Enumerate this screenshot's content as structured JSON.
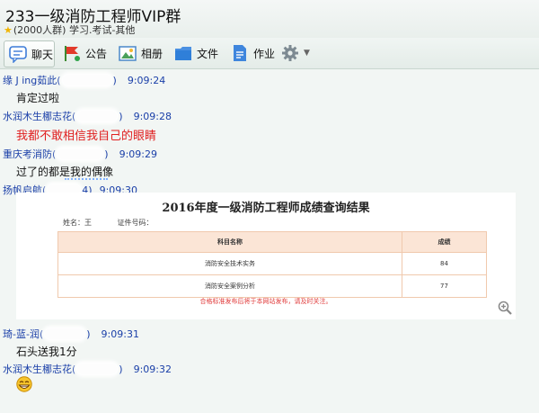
{
  "window": {
    "title": "233一级消防工程师VIP群",
    "subtitle": "(2000人群) 学习.考试-其他"
  },
  "toolbar": {
    "items": [
      {
        "label": "聊天",
        "icon": "chat-icon",
        "active": true
      },
      {
        "label": "公告",
        "icon": "announcement-icon"
      },
      {
        "label": "相册",
        "icon": "album-icon"
      },
      {
        "label": "文件",
        "icon": "folder-icon"
      },
      {
        "label": "作业",
        "icon": "homework-icon"
      },
      {
        "label": "",
        "icon": "gear-icon"
      }
    ]
  },
  "messages": [
    {
      "sender": "缘 J ing茹此(",
      "suffix": ")",
      "time": "9:09:24",
      "text": "肯定过啦"
    },
    {
      "sender": "水润木生梛志花(",
      "suffix": ")",
      "time": "9:09:28",
      "text": "我都不敢相信我自己的眼睛"
    },
    {
      "sender": "重庆考消防(",
      "suffix": ")",
      "time": "9:09:29",
      "text": "过了的都是我的偶像"
    },
    {
      "sender": "扬帆启航(",
      "suffix": "4)",
      "time": "9:09:30",
      "text": ""
    },
    {
      "sender": "琦-蓝-润(",
      "suffix": ")",
      "time": "9:09:31",
      "text": "石头送我1分"
    },
    {
      "sender": "水润木生梛志花(",
      "suffix": ")",
      "time": "9:09:32",
      "text": ""
    }
  ],
  "result_image": {
    "title": "2016年度一级消防工程师成绩查询结果",
    "name_label": "姓名：王",
    "id_label": "证件号码：",
    "columns": [
      "科目名称",
      "成绩"
    ],
    "rows": [
      {
        "subject": "消防安全技术实务",
        "score": "84"
      },
      {
        "subject": "消防安全案例分析",
        "score": "77"
      }
    ],
    "note": "合格标准发布后将于本网站发布，请及时关注。"
  },
  "colors": {
    "sender": "#1a3fa8",
    "highlight_text": "#e02020",
    "table_header": "#fbe5d6"
  }
}
